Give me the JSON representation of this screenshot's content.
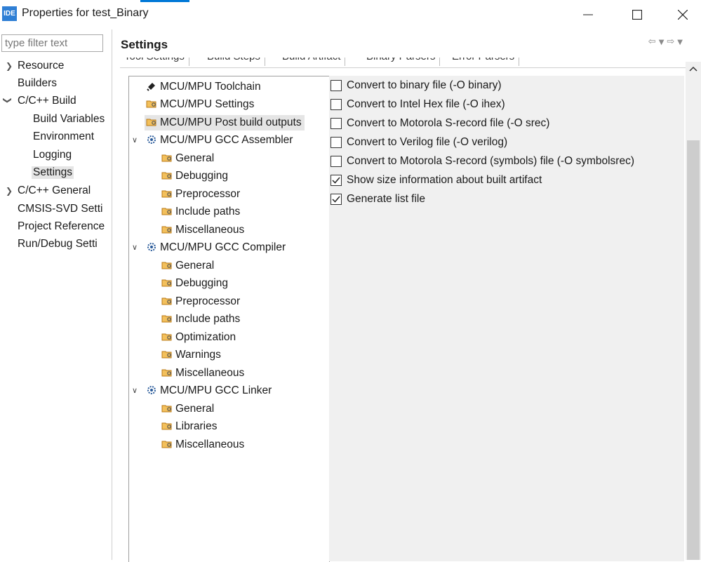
{
  "window": {
    "app_icon_text": "IDE",
    "title": "Properties for test_Binary",
    "controls": [
      "minimize",
      "maximize",
      "close"
    ]
  },
  "filter": {
    "placeholder": "type filter text"
  },
  "nav": {
    "items": [
      {
        "label": "Resource",
        "expander": "collapsed"
      },
      {
        "label": "Builders",
        "expander": "none"
      },
      {
        "label": "C/C++ Build",
        "expander": "expanded"
      },
      {
        "label": "Build Variables",
        "expander": "none"
      },
      {
        "label": "Environment",
        "expander": "none"
      },
      {
        "label": "Logging",
        "expander": "none"
      },
      {
        "label": "Settings",
        "expander": "none",
        "selected": true
      },
      {
        "label": "C/C++ General",
        "expander": "collapsed"
      },
      {
        "label": "CMSIS-SVD Setti",
        "expander": "none"
      },
      {
        "label": "Project Reference",
        "expander": "none"
      },
      {
        "label": "Run/Debug Setti",
        "expander": "none"
      }
    ]
  },
  "header": {
    "title": "Settings"
  },
  "tabs": [
    "Tool Settings",
    "Build Steps",
    "Build Artifact",
    "Binary Parsers",
    "Error Parsers"
  ],
  "tree": {
    "items": [
      {
        "label": "MCU/MPU Toolchain",
        "icon": "toolchain-icon"
      },
      {
        "label": "MCU/MPU Settings",
        "icon": "folder-icon"
      },
      {
        "label": "MCU/MPU Post build outputs",
        "icon": "folder-icon",
        "selected": true
      },
      {
        "label": "MCU/MPU GCC Assembler",
        "icon": "tool-icon",
        "expander": "expanded"
      },
      {
        "label": "General",
        "icon": "folder-icon"
      },
      {
        "label": "Debugging",
        "icon": "folder-icon"
      },
      {
        "label": "Preprocessor",
        "icon": "folder-icon"
      },
      {
        "label": "Include paths",
        "icon": "folder-icon"
      },
      {
        "label": "Miscellaneous",
        "icon": "folder-icon"
      },
      {
        "label": "MCU/MPU GCC Compiler",
        "icon": "tool-icon",
        "expander": "expanded"
      },
      {
        "label": "General",
        "icon": "folder-icon"
      },
      {
        "label": "Debugging",
        "icon": "folder-icon"
      },
      {
        "label": "Preprocessor",
        "icon": "folder-icon"
      },
      {
        "label": "Include paths",
        "icon": "folder-icon"
      },
      {
        "label": "Optimization",
        "icon": "folder-icon"
      },
      {
        "label": "Warnings",
        "icon": "folder-icon"
      },
      {
        "label": "Miscellaneous",
        "icon": "folder-icon"
      },
      {
        "label": "MCU/MPU GCC Linker",
        "icon": "tool-icon",
        "expander": "expanded"
      },
      {
        "label": "General",
        "icon": "folder-icon"
      },
      {
        "label": "Libraries",
        "icon": "folder-icon"
      },
      {
        "label": "Miscellaneous",
        "icon": "folder-icon"
      }
    ]
  },
  "options": [
    {
      "label": "Convert to binary file (-O binary)",
      "checked": false
    },
    {
      "label": "Convert to Intel Hex file (-O ihex)",
      "checked": false
    },
    {
      "label": "Convert to Motorola S-record file (-O srec)",
      "checked": false
    },
    {
      "label": "Convert to Verilog file (-O verilog)",
      "checked": false
    },
    {
      "label": "Convert to Motorola S-record (symbols) file (-O symbolsrec)",
      "checked": false
    },
    {
      "label": "Show size information about built artifact",
      "checked": true
    },
    {
      "label": "Generate list file",
      "checked": true
    }
  ],
  "colors": {
    "accent": "#0078d7",
    "selection": "#e5e5e5",
    "panel_bg": "#f0f0f0",
    "folder": "#e8a33c"
  }
}
